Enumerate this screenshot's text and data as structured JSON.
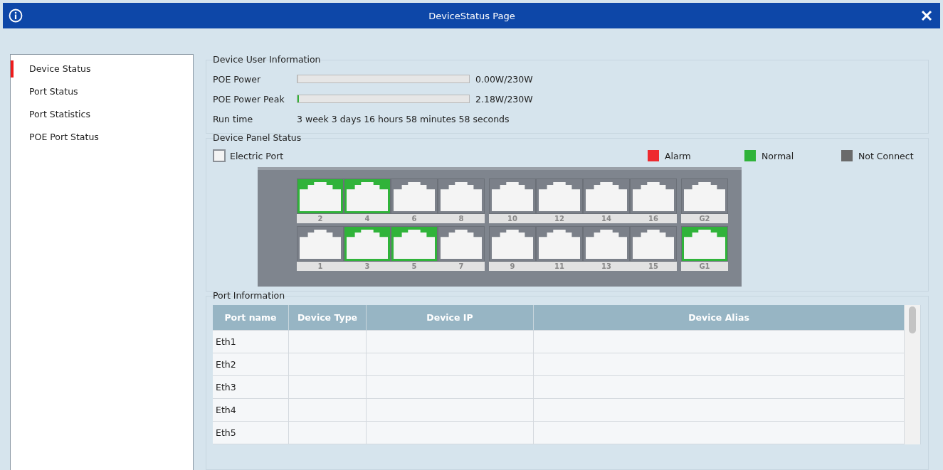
{
  "window": {
    "title": "DeviceStatus Page"
  },
  "sidebar": {
    "items": [
      {
        "label": "Device Status",
        "selected": true
      },
      {
        "label": "Port Status",
        "selected": false
      },
      {
        "label": "Port Statistics",
        "selected": false
      },
      {
        "label": "POE Port Status",
        "selected": false
      }
    ]
  },
  "user_info": {
    "title": "Device User Information",
    "meters": [
      {
        "label": "POE Power",
        "level": 0,
        "reading": "0.00W/230W"
      },
      {
        "label": "POE Power Peak",
        "level": 0.01,
        "reading": "2.18W/230W"
      }
    ],
    "run_time": {
      "label": "Run time",
      "value": "3 week 3 days 16 hours 58 minutes 58 seconds"
    }
  },
  "panel": {
    "title": "Device Panel Status",
    "port_legend": "Electric Port",
    "legend": [
      {
        "label": "Alarm",
        "color": "#ee2a2f"
      },
      {
        "label": "Normal",
        "color": "#30b33a"
      },
      {
        "label": "Not Connect",
        "color": "#6a6a6a"
      }
    ],
    "blocks": [
      {
        "top": [
          {
            "label": "2",
            "connected": true
          },
          {
            "label": "4",
            "connected": true
          },
          {
            "label": "6",
            "connected": false
          },
          {
            "label": "8",
            "connected": false
          }
        ],
        "bottom": [
          {
            "label": "1",
            "connected": false
          },
          {
            "label": "3",
            "connected": true
          },
          {
            "label": "5",
            "connected": true
          },
          {
            "label": "7",
            "connected": false
          }
        ]
      },
      {
        "top": [
          {
            "label": "10",
            "connected": false
          },
          {
            "label": "12",
            "connected": false
          },
          {
            "label": "14",
            "connected": false
          },
          {
            "label": "16",
            "connected": false
          }
        ],
        "bottom": [
          {
            "label": "9",
            "connected": false
          },
          {
            "label": "11",
            "connected": false
          },
          {
            "label": "13",
            "connected": false
          },
          {
            "label": "15",
            "connected": false
          }
        ]
      },
      {
        "top": [
          {
            "label": "G2",
            "connected": false
          }
        ],
        "bottom": [
          {
            "label": "G1",
            "connected": true
          }
        ]
      }
    ]
  },
  "port_info": {
    "title": "Port Information",
    "table": {
      "columns": [
        "Port name",
        "Device Type",
        "Device IP",
        "Device Alias"
      ],
      "rows": [
        [
          "Eth1",
          "",
          "",
          ""
        ],
        [
          "Eth2",
          "",
          "",
          ""
        ],
        [
          "Eth3",
          "",
          "",
          ""
        ],
        [
          "Eth4",
          "",
          "",
          ""
        ],
        [
          "Eth5",
          "",
          "",
          ""
        ]
      ]
    }
  }
}
